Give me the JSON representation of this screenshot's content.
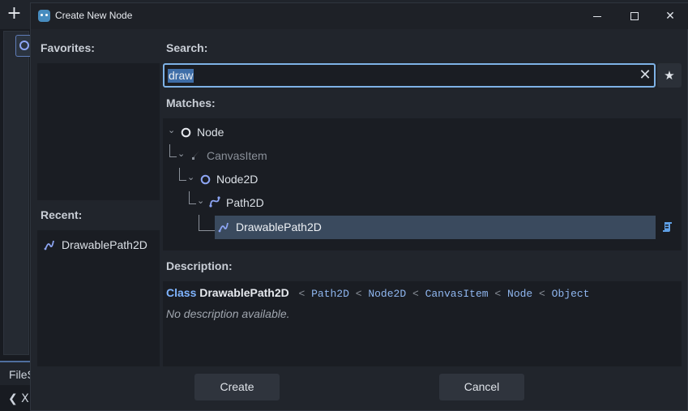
{
  "background": {
    "add_label": "+",
    "filesystem_tab_label": "FileS",
    "nav_back_label": "❮ X"
  },
  "dialog": {
    "title": "Create New Node",
    "favorites_label": "Favorites:",
    "recent_label": "Recent:",
    "recent_items": [
      {
        "label": "DrawablePath2D",
        "icon": "path-curve-icon"
      }
    ],
    "search_label": "Search:",
    "search_value": "draw",
    "matches_label": "Matches:",
    "tree": [
      {
        "label": "Node",
        "icon": "node-circle-icon",
        "depth": 0,
        "dimmed": false,
        "selected": false
      },
      {
        "label": "CanvasItem",
        "icon": "brush-icon",
        "depth": 1,
        "dimmed": true,
        "selected": false
      },
      {
        "label": "Node2D",
        "icon": "node2d-circle-icon",
        "depth": 2,
        "dimmed": false,
        "selected": false
      },
      {
        "label": "Path2D",
        "icon": "path2d-icon",
        "depth": 3,
        "dimmed": false,
        "selected": false
      },
      {
        "label": "DrawablePath2D",
        "icon": "path-curve-icon",
        "depth": 4,
        "dimmed": false,
        "selected": true
      }
    ],
    "description_label": "Description:",
    "description": {
      "keyword": "Class",
      "class_name": "DrawablePath2D",
      "inheritance": [
        "Path2D",
        "Node2D",
        "CanvasItem",
        "Node",
        "Object"
      ],
      "separator": "<",
      "body": "No description available."
    },
    "create_label": "Create",
    "cancel_label": "Cancel"
  },
  "colors": {
    "accent": "#7eb2e6",
    "selection": "#3a4a5e",
    "node_icon": "#8da5f3"
  }
}
